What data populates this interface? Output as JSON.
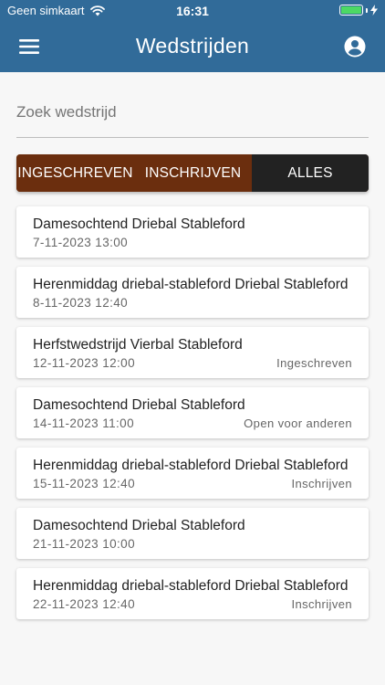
{
  "status_bar": {
    "carrier": "Geen simkaart",
    "time": "16:31",
    "battery_color": "#4cd964"
  },
  "app_bar": {
    "title": "Wedstrijden",
    "menu_icon": "menu-icon",
    "account_icon": "account-icon",
    "background": "#316b99"
  },
  "search": {
    "placeholder": "Zoek wedstrijd",
    "value": ""
  },
  "tabs": [
    {
      "label": "INGESCHREVEN",
      "color": "#6b2e0e"
    },
    {
      "label": "INSCHRIJVEN",
      "color": "#6b2e0e"
    },
    {
      "label": "ALLES",
      "color": "#222222"
    }
  ],
  "matches": [
    {
      "title": "Damesochtend Driebal Stableford",
      "date": "7-11-2023 13:00",
      "status": ""
    },
    {
      "title": "Herenmiddag driebal-stableford Driebal Stableford",
      "date": "8-11-2023 12:40",
      "status": ""
    },
    {
      "title": "Herfstwedstrijd Vierbal Stableford",
      "date": "12-11-2023 12:00",
      "status": "Ingeschreven"
    },
    {
      "title": "Damesochtend Driebal Stableford",
      "date": "14-11-2023 11:00",
      "status": "Open voor anderen"
    },
    {
      "title": "Herenmiddag driebal-stableford Driebal Stableford",
      "date": "15-11-2023 12:40",
      "status": "Inschrijven"
    },
    {
      "title": "Damesochtend Driebal Stableford",
      "date": "21-11-2023 10:00",
      "status": ""
    },
    {
      "title": "Herenmiddag driebal-stableford Driebal Stableford",
      "date": "22-11-2023 12:40",
      "status": "Inschrijven"
    }
  ]
}
